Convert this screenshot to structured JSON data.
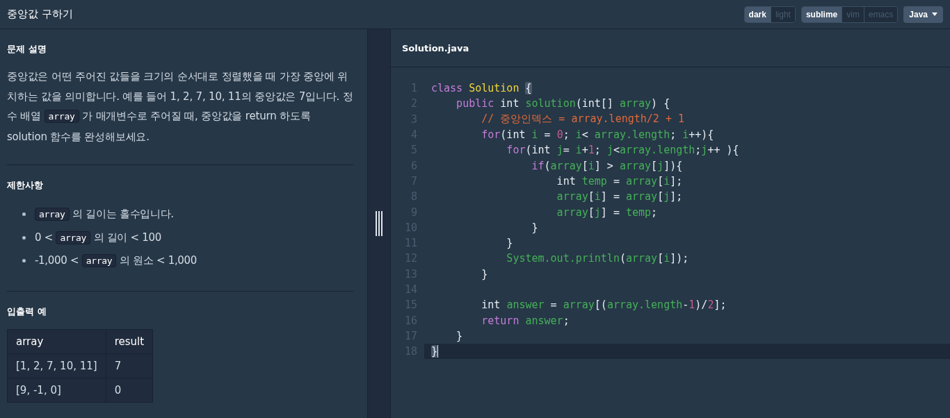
{
  "window": {
    "title": "중앙값 구하기"
  },
  "theme_toggle": [
    {
      "label": "dark",
      "selected": true
    },
    {
      "label": "light",
      "selected": false
    }
  ],
  "keymap_toggle": [
    {
      "label": "sublime",
      "selected": true
    },
    {
      "label": "vim",
      "selected": false
    },
    {
      "label": "emacs",
      "selected": false
    }
  ],
  "language_dropdown": {
    "value": "Java"
  },
  "description": {
    "heading": "문제 설명",
    "paragraph": [
      {
        "kind": "text",
        "text": "중앙값은 어떤 주어진 값들을 크기의 순서대로 정렬했을 때 가장 중앙에 위치하는 값을 의미합니다. 예를 들어 1, 2, 7, 10, 11의 중앙값은 7입니다. 정수 배열 "
      },
      {
        "kind": "code",
        "text": "array"
      },
      {
        "kind": "text",
        "text": " 가 매개변수로 주어질 때, 중앙값을 return 하도록 solution 함수를 완성해보세요."
      }
    ]
  },
  "constraints": {
    "heading": "제한사항",
    "items": [
      [
        {
          "kind": "code",
          "text": "array"
        },
        {
          "kind": "text",
          "text": " 의 길이는 홀수입니다."
        }
      ],
      [
        {
          "kind": "text",
          "text": "0 < "
        },
        {
          "kind": "code",
          "text": "array"
        },
        {
          "kind": "text",
          "text": " 의 길이 < 100"
        }
      ],
      [
        {
          "kind": "text",
          "text": "-1,000 < "
        },
        {
          "kind": "code",
          "text": "array"
        },
        {
          "kind": "text",
          "text": " 의 원소 < 1,000"
        }
      ]
    ]
  },
  "examples": {
    "heading": "입출력 예",
    "columns": [
      "array",
      "result"
    ],
    "rows": [
      [
        "[1, 2, 7, 10, 11]",
        "7"
      ],
      [
        "[9, -1, 0]",
        "0"
      ]
    ]
  },
  "editor": {
    "filename": "Solution.java",
    "lines": [
      {
        "n": "1",
        "tokens": [
          {
            "text": "class ",
            "kind": "kw"
          },
          {
            "text": "Solution ",
            "kind": "cls"
          },
          {
            "text": "{",
            "kind": "match"
          }
        ]
      },
      {
        "n": "2",
        "tokens": [
          {
            "text": "    public",
            "kind": "kw"
          },
          {
            "text": " int ",
            "kind": "p"
          },
          {
            "text": "solution",
            "kind": "g"
          },
          {
            "text": "(int[] ",
            "kind": "p"
          },
          {
            "text": "array",
            "kind": "g"
          },
          {
            "text": ") {",
            "kind": "p"
          }
        ]
      },
      {
        "n": "3",
        "tokens": [
          {
            "text": "        // 중앙인덱스 = array.length/2 + 1",
            "kind": "cm"
          }
        ]
      },
      {
        "n": "4",
        "tokens": [
          {
            "text": "        for",
            "kind": "kw"
          },
          {
            "text": "(int ",
            "kind": "p"
          },
          {
            "text": "i",
            "kind": "g"
          },
          {
            "text": " = ",
            "kind": "p"
          },
          {
            "text": "0",
            "kind": "num"
          },
          {
            "text": "; ",
            "kind": "p"
          },
          {
            "text": "i",
            "kind": "g"
          },
          {
            "text": "< ",
            "kind": "p"
          },
          {
            "text": "array.length",
            "kind": "g"
          },
          {
            "text": "; ",
            "kind": "p"
          },
          {
            "text": "i",
            "kind": "g"
          },
          {
            "text": "++){",
            "kind": "p"
          }
        ]
      },
      {
        "n": "5",
        "tokens": [
          {
            "text": "            for",
            "kind": "kw"
          },
          {
            "text": "(int ",
            "kind": "p"
          },
          {
            "text": "j",
            "kind": "g"
          },
          {
            "text": "= ",
            "kind": "p"
          },
          {
            "text": "i",
            "kind": "g"
          },
          {
            "text": "+",
            "kind": "p"
          },
          {
            "text": "1",
            "kind": "num"
          },
          {
            "text": "; ",
            "kind": "p"
          },
          {
            "text": "j",
            "kind": "g"
          },
          {
            "text": "<",
            "kind": "p"
          },
          {
            "text": "array.length",
            "kind": "g"
          },
          {
            "text": ";",
            "kind": "p"
          },
          {
            "text": "j",
            "kind": "g"
          },
          {
            "text": "++ ){",
            "kind": "p"
          }
        ]
      },
      {
        "n": "6",
        "tokens": [
          {
            "text": "                if",
            "kind": "kw"
          },
          {
            "text": "(",
            "kind": "p"
          },
          {
            "text": "array",
            "kind": "g"
          },
          {
            "text": "[",
            "kind": "p"
          },
          {
            "text": "i",
            "kind": "g"
          },
          {
            "text": "] > ",
            "kind": "p"
          },
          {
            "text": "array",
            "kind": "g"
          },
          {
            "text": "[",
            "kind": "p"
          },
          {
            "text": "j",
            "kind": "g"
          },
          {
            "text": "]){",
            "kind": "p"
          }
        ]
      },
      {
        "n": "7",
        "tokens": [
          {
            "text": "                    int ",
            "kind": "p"
          },
          {
            "text": "temp",
            "kind": "g"
          },
          {
            "text": " = ",
            "kind": "p"
          },
          {
            "text": "array",
            "kind": "g"
          },
          {
            "text": "[",
            "kind": "p"
          },
          {
            "text": "i",
            "kind": "g"
          },
          {
            "text": "];",
            "kind": "p"
          }
        ]
      },
      {
        "n": "8",
        "tokens": [
          {
            "text": "                    array",
            "kind": "g"
          },
          {
            "text": "[",
            "kind": "p"
          },
          {
            "text": "i",
            "kind": "g"
          },
          {
            "text": "] = ",
            "kind": "p"
          },
          {
            "text": "array",
            "kind": "g"
          },
          {
            "text": "[",
            "kind": "p"
          },
          {
            "text": "j",
            "kind": "g"
          },
          {
            "text": "];",
            "kind": "p"
          }
        ]
      },
      {
        "n": "9",
        "tokens": [
          {
            "text": "                    array",
            "kind": "g"
          },
          {
            "text": "[",
            "kind": "p"
          },
          {
            "text": "j",
            "kind": "g"
          },
          {
            "text": "] = ",
            "kind": "p"
          },
          {
            "text": "temp",
            "kind": "g"
          },
          {
            "text": ";",
            "kind": "p"
          }
        ]
      },
      {
        "n": "10",
        "tokens": [
          {
            "text": "                }",
            "kind": "p"
          }
        ]
      },
      {
        "n": "11",
        "tokens": [
          {
            "text": "            }",
            "kind": "p"
          }
        ]
      },
      {
        "n": "12",
        "tokens": [
          {
            "text": "            System.out.println",
            "kind": "g"
          },
          {
            "text": "(",
            "kind": "p"
          },
          {
            "text": "array",
            "kind": "g"
          },
          {
            "text": "[",
            "kind": "p"
          },
          {
            "text": "i",
            "kind": "g"
          },
          {
            "text": "]);",
            "kind": "p"
          }
        ]
      },
      {
        "n": "13",
        "tokens": [
          {
            "text": "        }",
            "kind": "p"
          }
        ]
      },
      {
        "n": "14",
        "current": false
      },
      {
        "n": "15",
        "tokens": [
          {
            "text": "        int ",
            "kind": "p"
          },
          {
            "text": "answer",
            "kind": "g"
          },
          {
            "text": " = ",
            "kind": "p"
          },
          {
            "text": "array",
            "kind": "g"
          },
          {
            "text": "[(",
            "kind": "p"
          },
          {
            "text": "array.length",
            "kind": "g"
          },
          {
            "text": "-",
            "kind": "p"
          },
          {
            "text": "1",
            "kind": "num"
          },
          {
            "text": ")/",
            "kind": "p"
          },
          {
            "text": "2",
            "kind": "num"
          },
          {
            "text": "];",
            "kind": "p"
          }
        ]
      },
      {
        "n": "16",
        "tokens": [
          {
            "text": "        return ",
            "kind": "kw"
          },
          {
            "text": "answer",
            "kind": "g"
          },
          {
            "text": ";",
            "kind": "p"
          }
        ]
      },
      {
        "n": "17",
        "tokens": [
          {
            "text": "    }",
            "kind": "p"
          }
        ]
      },
      {
        "n": "18",
        "current": true,
        "tokens": [
          {
            "text": "}",
            "kind": "match"
          }
        ]
      }
    ]
  }
}
